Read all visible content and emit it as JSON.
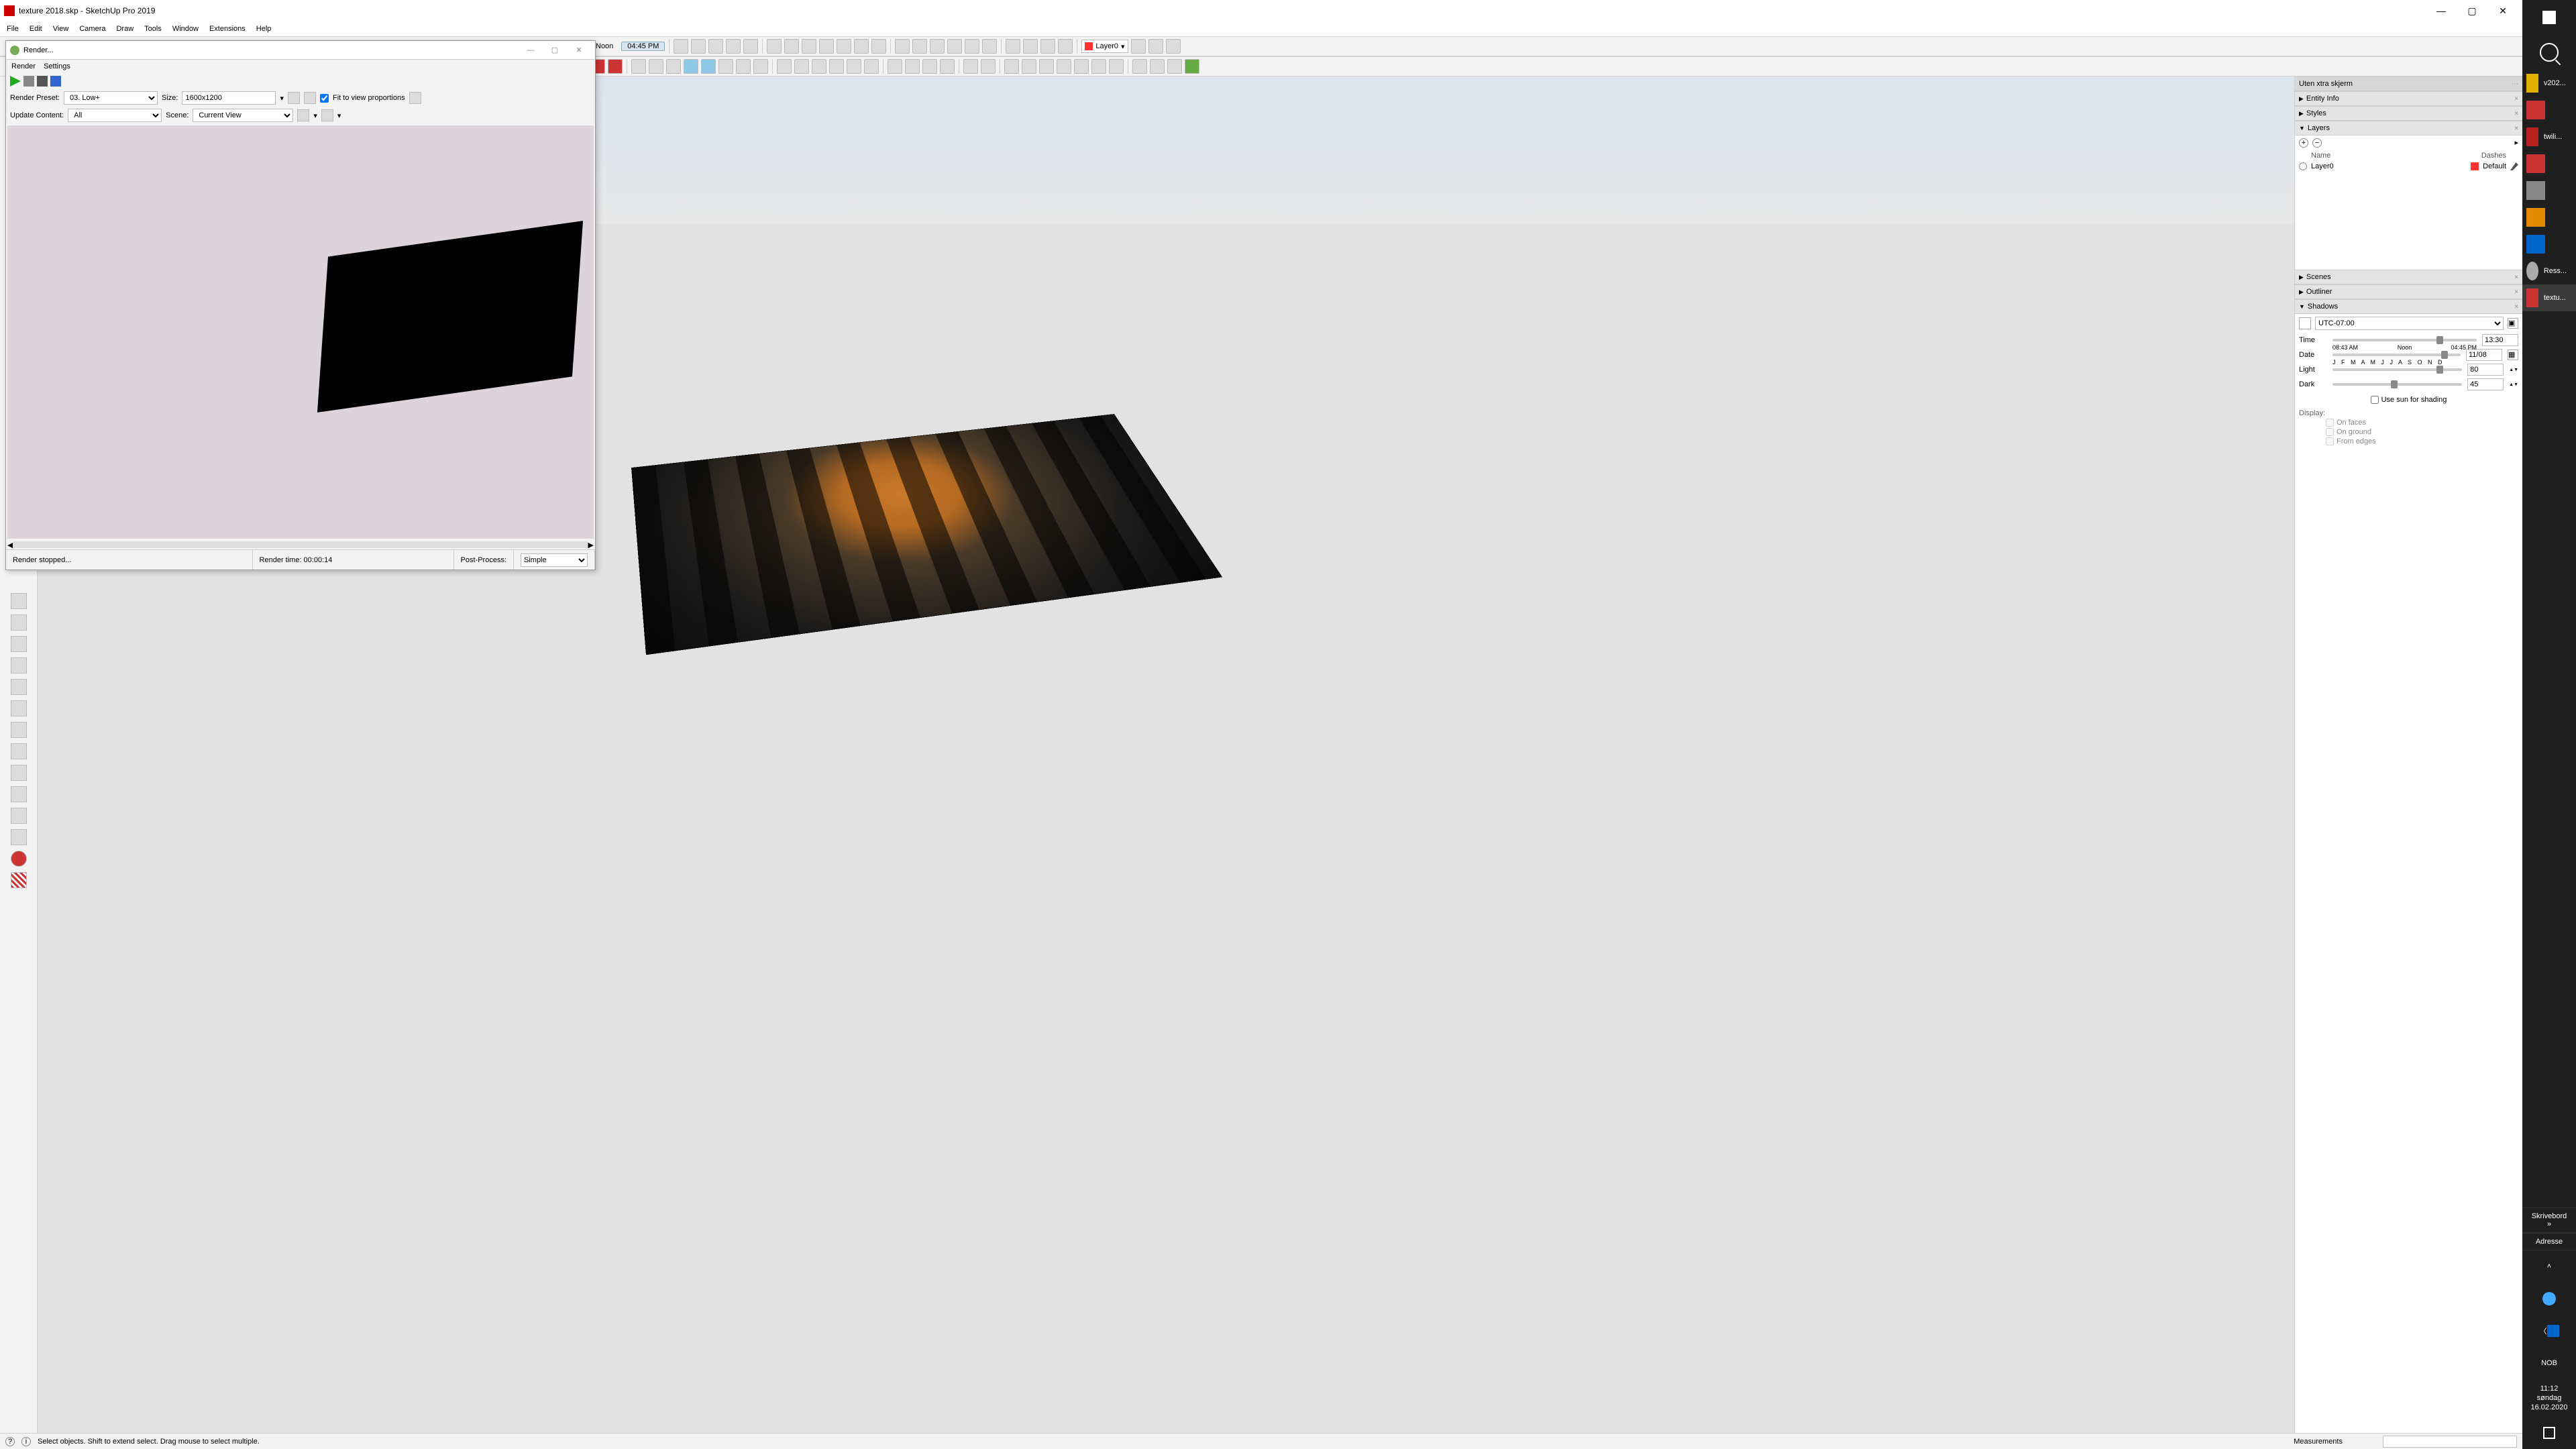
{
  "window": {
    "title": "texture 2018.skp - SketchUp Pro 2019",
    "min": "—",
    "max": "▢",
    "close": "✕"
  },
  "menu": [
    "File",
    "Edit",
    "View",
    "Camera",
    "Draw",
    "Tools",
    "Window",
    "Extensions",
    "Help"
  ],
  "time_toolbar": {
    "noon": "Noon",
    "selected": "04:45 PM"
  },
  "layer_toolbar": {
    "value": "Layer0"
  },
  "right": {
    "title": "Uten xtra skjerm",
    "panels": {
      "entity": "Entity Info",
      "styles": "Styles",
      "layers": "Layers",
      "scenes": "Scenes",
      "outliner": "Outliner",
      "shadows": "Shadows"
    },
    "layers": {
      "cols": {
        "name": "Name",
        "dashes": "Dashes"
      },
      "row": {
        "name": "Layer0",
        "dash": "Default"
      }
    },
    "shadows": {
      "tz": "UTC-07:00",
      "time_label": "Time",
      "time_start": "08:43 AM",
      "time_noon": "Noon",
      "time_sel": "04:45 PM",
      "time_val": "13:30",
      "date_label": "Date",
      "date_months": "J F M A M J J A S O N D",
      "date_val": "11/08",
      "light_label": "Light",
      "light_val": "80",
      "dark_label": "Dark",
      "dark_val": "45",
      "use_sun": "Use sun for shading",
      "display": "Display:",
      "on_faces": "On faces",
      "on_ground": "On ground",
      "from_edges": "From edges"
    }
  },
  "status": {
    "hint": "Select objects. Shift to extend select. Drag mouse to select multiple.",
    "meas": "Measurements"
  },
  "render": {
    "title": "Render...",
    "menu": [
      "Render",
      "Settings"
    ],
    "preset_label": "Render Preset:",
    "preset_value": "03. Low+",
    "size_label": "Size:",
    "size_value": "1600x1200",
    "fit_label": "Fit to view proportions",
    "update_label": "Update Content:",
    "update_value": "All",
    "scene_label": "Scene:",
    "scene_value": "Current View",
    "status_left": "Render stopped...",
    "status_time": "Render time: 00:00:14",
    "post_label": "Post-Process:",
    "post_value": "Simple"
  },
  "taskbar": {
    "apps": [
      "v202...",
      "",
      "twili...",
      "",
      "",
      "",
      "",
      "",
      "Ress...",
      "textu..."
    ],
    "desktop": "Skrivebord",
    "address": "Adresse",
    "lang": "NOB",
    "time": "11:12",
    "day": "søndag",
    "date": "16.02.2020"
  }
}
